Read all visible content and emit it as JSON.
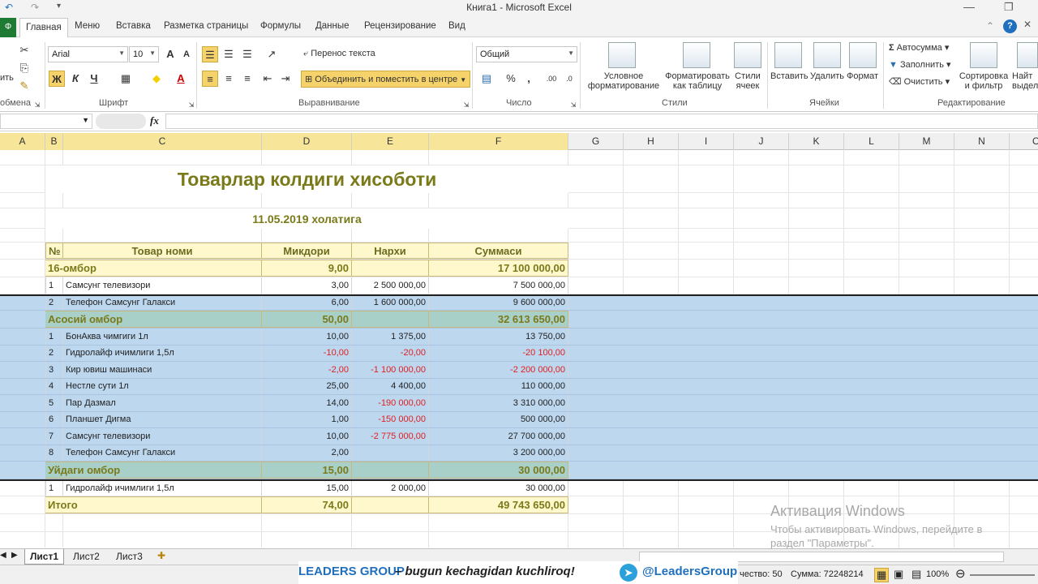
{
  "window": {
    "title": "Книга1 - Microsoft Excel"
  },
  "tabs": {
    "file": "Ф",
    "items": [
      "Главная",
      "Меню",
      "Вставка",
      "Разметка страницы",
      "Формулы",
      "Данные",
      "Рецензирование",
      "Вид"
    ]
  },
  "ribbon": {
    "clipboard": {
      "paste_partial": "ить",
      "group": "обмена"
    },
    "font": {
      "name": "Arial",
      "size": "10",
      "bold": "Ж",
      "italic": "К",
      "underline": "Ч",
      "group": "Шрифт"
    },
    "alignment": {
      "wrap": "Перенос текста",
      "merge": "Объединить и поместить в центре",
      "group": "Выравнивание"
    },
    "number": {
      "format": "Общий",
      "percent": "%",
      "comma": ",",
      "group": "Число"
    },
    "styles": {
      "conditional": [
        "Условное",
        "форматирование"
      ],
      "table": [
        "Форматировать",
        "как таблицу"
      ],
      "cells": [
        "Стили",
        "ячеек"
      ],
      "group": "Стили"
    },
    "cells": {
      "insert": "Вставить",
      "delete": "Удалить",
      "format": "Формат",
      "group": "Ячейки"
    },
    "editing": {
      "autosum": "Автосумма",
      "fill": "Заполнить",
      "clear": "Очистить",
      "sort": [
        "Сортировка",
        "и фильтр"
      ],
      "find": [
        "Найт",
        "выдел"
      ],
      "group": "Редактирование"
    }
  },
  "formula_bar": {
    "fx": "fx"
  },
  "columns": [
    "A",
    "B",
    "C",
    "D",
    "E",
    "F",
    "G",
    "H",
    "I",
    "J",
    "K",
    "L",
    "M",
    "N",
    "O"
  ],
  "sheet": {
    "title": "Товарлар колдиги хисоботи",
    "subtitle": "11.05.2019 холатига",
    "headers": [
      "№",
      "Товар номи",
      "Микдори",
      "Нархи",
      "Суммаси"
    ],
    "rows": [
      {
        "type": "group",
        "num": "",
        "name": "16-омбор",
        "qty": "9,00",
        "price": "",
        "sum": "17 100 000,00"
      },
      {
        "type": "item",
        "num": "1",
        "name": "Самсунг телевизори",
        "qty": "3,00",
        "price": "2 500 000,00",
        "sum": "7 500 000,00"
      },
      {
        "type": "item",
        "num": "2",
        "name": "Телефон Самсунг Галакси",
        "qty": "6,00",
        "price": "1 600 000,00",
        "sum": "9 600 000,00"
      },
      {
        "type": "group",
        "num": "",
        "name": "Асосий омбор",
        "qty": "50,00",
        "price": "",
        "sum": "32 613 650,00"
      },
      {
        "type": "item",
        "num": "1",
        "name": "БонАква чимгиги 1л",
        "qty": "10,00",
        "price": "1 375,00",
        "sum": "13 750,00"
      },
      {
        "type": "item",
        "num": "2",
        "name": "Гидролайф ичимлиги 1,5л",
        "qty": "-10,00",
        "price": "-20,00",
        "sum": "-20 100,00"
      },
      {
        "type": "item",
        "num": "3",
        "name": "Кир ювиш машинаси",
        "qty": "-2,00",
        "price": "-1 100 000,00",
        "sum": "-2 200 000,00"
      },
      {
        "type": "item",
        "num": "4",
        "name": "Нестле сути 1л",
        "qty": "25,00",
        "price": "4 400,00",
        "sum": "110 000,00"
      },
      {
        "type": "item",
        "num": "5",
        "name": "Пар Дазмал",
        "qty": "14,00",
        "price": "-190 000,00",
        "sum": "3 310 000,00"
      },
      {
        "type": "item",
        "num": "6",
        "name": "Планшет Дигма",
        "qty": "1,00",
        "price": "-150 000,00",
        "sum": "500 000,00"
      },
      {
        "type": "item",
        "num": "7",
        "name": "Самсунг телевизори",
        "qty": "10,00",
        "price": "-2 775 000,00",
        "sum": "27 700 000,00"
      },
      {
        "type": "item",
        "num": "8",
        "name": "Телефон Самсунг Галакси",
        "qty": "2,00",
        "price": "",
        "sum": "3 200 000,00"
      },
      {
        "type": "group",
        "num": "",
        "name": "Уйдаги омбор",
        "qty": "15,00",
        "price": "",
        "sum": "30 000,00"
      },
      {
        "type": "item",
        "num": "1",
        "name": "Гидролайф ичимлиги 1,5л",
        "qty": "15,00",
        "price": "2 000,00",
        "sum": "30 000,00"
      },
      {
        "type": "total",
        "num": "",
        "name": "Итого",
        "qty": "74,00",
        "price": "",
        "sum": "49 743 650,00"
      }
    ]
  },
  "sheets": [
    "Лист1",
    "Лист2",
    "Лист3"
  ],
  "status": {
    "count": "чество: 50",
    "sum": "Сумма: 72248214",
    "zoom": "100%"
  },
  "banner": {
    "brand": "LEADERS GROUP",
    "slogan": " – bugun kechagidan kuchliroq!",
    "handle": "@LeadersGroup"
  },
  "watermark": {
    "line1": "Активация Windows",
    "line2": "Чтобы активировать Windows, перейдите в",
    "line3": "раздел \"Параметры\"."
  },
  "colors": {
    "excel_green": "#1f7a33",
    "selection_blue": "#bdd7ee",
    "group_teal": "#a9d0c8",
    "header_yellow": "#fff8cc",
    "title_olive": "#7a7a1a",
    "negative_red": "#e02020"
  }
}
